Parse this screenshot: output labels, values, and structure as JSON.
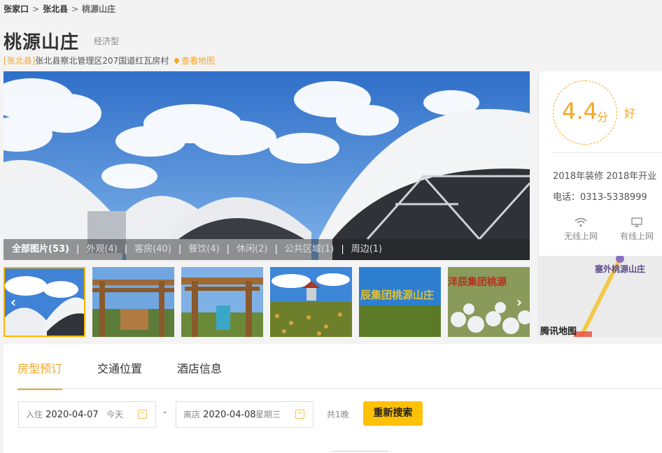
{
  "breadcrumb": {
    "city": "张家口",
    "county": "张北县",
    "current": "桃源山庄",
    "separator": ">"
  },
  "hotel": {
    "name": "桃源山庄",
    "grade": "经济型",
    "district": "[张北县]",
    "address": "张北县察北管理区207国道红瓦房村",
    "map_link": "查看地图"
  },
  "gallery": {
    "categories": [
      {
        "label": "全部图片(53)",
        "active": true
      },
      {
        "label": "外观(4)",
        "active": false
      },
      {
        "label": "客房(40)",
        "active": false
      },
      {
        "label": "餐饮(4)",
        "active": false
      },
      {
        "label": "休闲(2)",
        "active": false
      },
      {
        "label": "公共区域(1)",
        "active": false
      },
      {
        "label": "周边(1)",
        "active": false
      }
    ],
    "separator": "|",
    "prev_arrow": "‹",
    "next_arrow": "›",
    "thumb_signs": {
      "sign4": "辰集团桃源山庄",
      "sign5": "洋辰集团桃源"
    }
  },
  "rating": {
    "score": "4.4",
    "unit": "分",
    "word": "好",
    "open_info": "2018年装修 2018年开业",
    "phone": "电话：0313-5338999",
    "facilities": [
      {
        "label": "无线上网",
        "icon": "wifi-icon"
      },
      {
        "label": "有线上网",
        "icon": "monitor-icon"
      }
    ],
    "map_place": "塞外桃源山庄",
    "map_provider": "腾讯地图"
  },
  "booking": {
    "tabs": [
      "房型预订",
      "交通位置",
      "酒店信息"
    ],
    "active_tab": 0,
    "checkin": {
      "label": "入住",
      "date": "2020-04-07",
      "day": "今天"
    },
    "checkout": {
      "label": "离店",
      "date": "2020-04-08",
      "day": "星期三"
    },
    "dash": "-",
    "nights": "共1晚",
    "search_label": "重新搜索"
  },
  "colors": {
    "accent": "#f5a623",
    "button": "#ffc107",
    "sky": "#4d8ad8"
  }
}
